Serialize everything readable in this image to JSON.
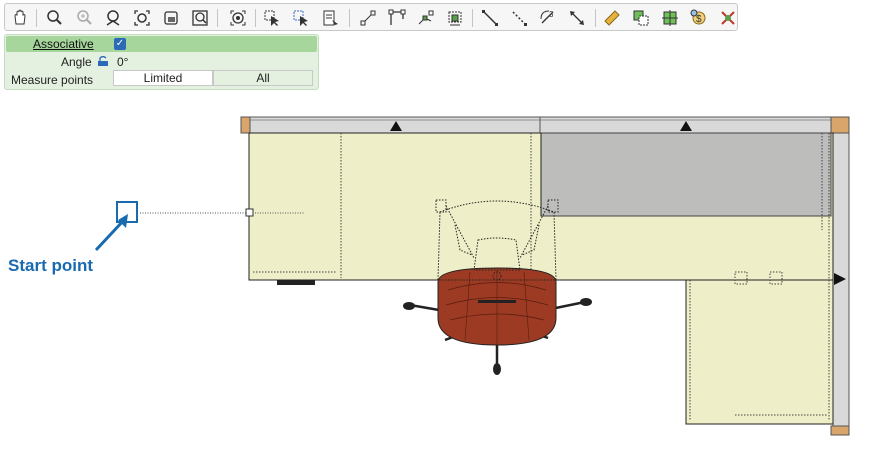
{
  "toolbar": {
    "icons": [
      "pan-hand-icon",
      "zoom-icon",
      "zoom-in-icon",
      "zoom-out-icon",
      "zoom-extents-icon",
      "zoom-window-icon",
      "zoom-previous-icon",
      "snap-icon",
      "select-icon",
      "select-crossing-icon",
      "properties-list-icon",
      "points-icon",
      "polyline-icon",
      "point-edit-icon",
      "group-edit-icon",
      "line-icon",
      "dashed-line-icon",
      "rotate-3d-icon",
      "dimension-icon",
      "ruler-icon",
      "copy-area-icon",
      "measure-area-icon",
      "cost-icon",
      "delete-icon"
    ]
  },
  "props": {
    "associative_label": "Associative",
    "associative_checked": true,
    "check_glyph": "✓",
    "angle_label": "Angle",
    "angle_value": "0°",
    "measure_points_label": "Measure points",
    "options": [
      "Limited",
      "All"
    ],
    "selected_option": "Limited"
  },
  "annotation": {
    "start_label": "Start point",
    "color": "#1a6ab0"
  },
  "colors": {
    "desk": "#eeefc8",
    "panel": "#bdbdbb",
    "chair_seat": "#9c3a23",
    "frame": "#d9d9d9",
    "post": "#d9a56a"
  }
}
